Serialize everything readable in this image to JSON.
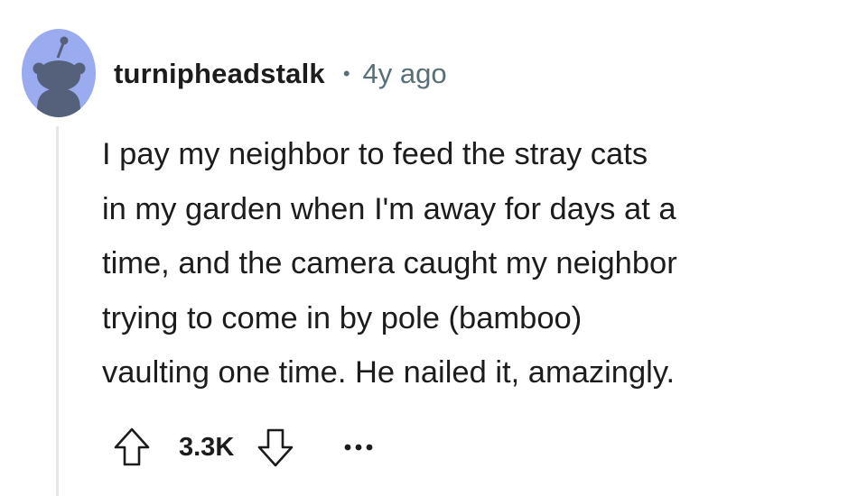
{
  "comment": {
    "avatar_icon": "snoo-avatar-icon",
    "username": "turnipheadstalk",
    "separator": "•",
    "timestamp": "4y ago",
    "body": "I pay my neighbor to feed the stray cats\nin my garden when I'm away for days at a\ntime, and the camera caught my neighbor\ntrying to come in by pole (bamboo)\nvaulting one time. He nailed it, amazingly.",
    "actions": {
      "upvote_icon": "upvote-arrow-icon",
      "score": "3.3K",
      "downvote_icon": "downvote-arrow-icon",
      "more_icon": "more-options-icon"
    }
  },
  "colors": {
    "avatar_background": "#9aabf0",
    "avatar_figure": "#55617a",
    "text": "#1c1c1c",
    "meta_text": "#576f76",
    "thread_line": "#e3e6ea",
    "icon_stroke": "#1c1c1c"
  }
}
